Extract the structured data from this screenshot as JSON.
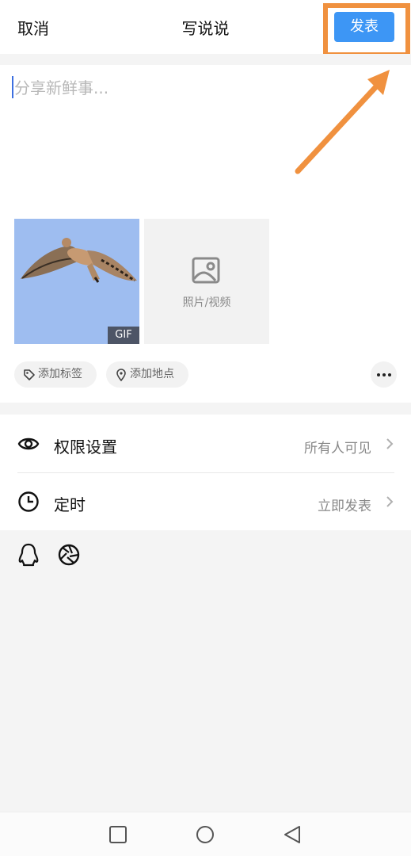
{
  "header": {
    "cancel_label": "取消",
    "title": "写说说",
    "publish_label": "发表"
  },
  "compose": {
    "placeholder": "分享新鲜事..."
  },
  "media": {
    "gif_badge": "GIF",
    "add_label": "照片/视频"
  },
  "chips": {
    "tag_label": "添加标签",
    "location_label": "添加地点"
  },
  "settings": {
    "permission": {
      "label": "权限设置",
      "value": "所有人可见"
    },
    "schedule": {
      "label": "定时",
      "value": "立即发表"
    }
  },
  "colors": {
    "accent": "#3D96F5",
    "highlight": "#F0913F",
    "divider_bg": "#f4f4f4"
  },
  "icons": {
    "share_targets": [
      "qq-penguin-icon",
      "camera-aperture-icon"
    ],
    "nav": [
      "recent-apps-icon",
      "home-icon",
      "back-icon"
    ]
  }
}
